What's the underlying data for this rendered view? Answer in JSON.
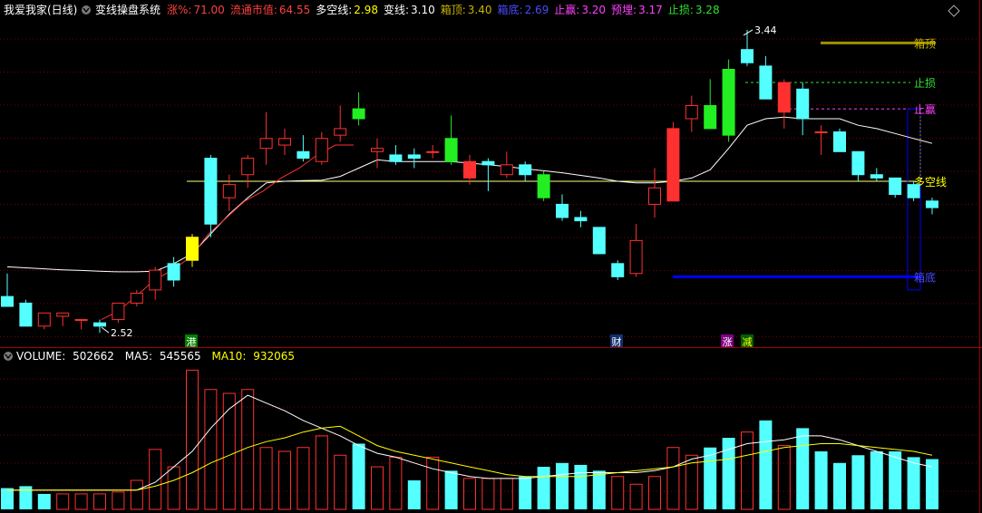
{
  "header": {
    "stock_name": "我爱我家(日线)",
    "system_name": "变线操盘系统",
    "items": [
      {
        "label": "涨%:",
        "value": "71.00",
        "label_color": "#ff4040",
        "value_color": "#ff4040"
      },
      {
        "label": "流通市值:",
        "value": "64.55",
        "label_color": "#ff4040",
        "value_color": "#ff4040"
      },
      {
        "label": "多空线:",
        "value": "2.98",
        "label_color": "#ffffff",
        "value_color": "#ffff00"
      },
      {
        "label": "变线:",
        "value": "3.10",
        "label_color": "#ffffff",
        "value_color": "#ffffff"
      },
      {
        "label": "箱顶:",
        "value": "3.40",
        "label_color": "#c8b400",
        "value_color": "#c8b400"
      },
      {
        "label": "箱底:",
        "value": "2.69",
        "label_color": "#4a4aff",
        "value_color": "#4a4aff"
      },
      {
        "label": "止赢:",
        "value": "3.20",
        "label_color": "#ff40ff",
        "value_color": "#ff40ff"
      },
      {
        "label": "预埋:",
        "value": "3.17",
        "label_color": "#ff40ff",
        "value_color": "#ff40ff"
      },
      {
        "label": "止损:",
        "value": "3.28",
        "label_color": "#30e030",
        "value_color": "#30e030"
      }
    ]
  },
  "volume_header": {
    "label": "VOLUME:",
    "value": "502662",
    "ma5_label": "MA5:",
    "ma5_value": "545565",
    "ma10_label": "MA10:",
    "ma10_value": "932065"
  },
  "markers": [
    "港",
    "财",
    "涨",
    "减"
  ],
  "colors": {
    "up": "#ff3030",
    "down": "#54ffff",
    "yellow_candle": "#ffff00",
    "green_candle": "#22ee22",
    "ma_line": "#ffffff",
    "bull_line": "#ff3030",
    "duokong": "#ffff80",
    "box_top": "#a09000",
    "box_bottom": "#0000ff",
    "stop_loss": "#30e030",
    "stop_profit": "#ff40ff",
    "grid": "#7a0000"
  },
  "chart_data": {
    "type": "candlestick",
    "price_annotations": {
      "high": "3.44",
      "low": "2.52"
    },
    "levels": [
      {
        "name": "箱顶",
        "value": 3.4
      },
      {
        "name": "止损",
        "value": 3.28
      },
      {
        "name": "止赢",
        "value": 3.2
      },
      {
        "name": "多空线",
        "value": 2.98
      },
      {
        "name": "箱底",
        "value": 2.69
      }
    ],
    "candles": [
      {
        "o": 2.63,
        "h": 2.7,
        "l": 2.6,
        "c": 2.6,
        "mark": ""
      },
      {
        "o": 2.61,
        "h": 2.62,
        "l": 2.54,
        "c": 2.54,
        "mark": ""
      },
      {
        "o": 2.54,
        "h": 2.58,
        "l": 2.53,
        "c": 2.58,
        "mark": ""
      },
      {
        "o": 2.57,
        "h": 2.58,
        "l": 2.54,
        "c": 2.58,
        "mark": ""
      },
      {
        "o": 2.56,
        "h": 2.56,
        "l": 2.53,
        "c": 2.56,
        "mark": ""
      },
      {
        "o": 2.55,
        "h": 2.56,
        "l": 2.52,
        "c": 2.54,
        "mark": ""
      },
      {
        "o": 2.56,
        "h": 2.61,
        "l": 2.55,
        "c": 2.61,
        "mark": ""
      },
      {
        "o": 2.61,
        "h": 2.65,
        "l": 2.6,
        "c": 2.64,
        "mark": ""
      },
      {
        "o": 2.65,
        "h": 2.72,
        "l": 2.62,
        "c": 2.71,
        "mark": ""
      },
      {
        "o": 2.73,
        "h": 2.75,
        "l": 2.66,
        "c": 2.68,
        "mark": ""
      },
      {
        "o": 2.74,
        "h": 2.82,
        "l": 2.72,
        "c": 2.81,
        "mark": "yellow"
      },
      {
        "o": 3.05,
        "h": 3.06,
        "l": 2.81,
        "c": 2.85,
        "mark": ""
      },
      {
        "o": 2.93,
        "h": 3.0,
        "l": 2.89,
        "c": 2.97,
        "mark": ""
      },
      {
        "o": 3.0,
        "h": 3.06,
        "l": 2.96,
        "c": 3.05,
        "mark": ""
      },
      {
        "o": 3.08,
        "h": 3.19,
        "l": 3.03,
        "c": 3.11,
        "mark": ""
      },
      {
        "o": 3.09,
        "h": 3.14,
        "l": 3.06,
        "c": 3.11,
        "mark": ""
      },
      {
        "o": 3.07,
        "h": 3.12,
        "l": 3.04,
        "c": 3.05,
        "mark": ""
      },
      {
        "o": 3.04,
        "h": 3.13,
        "l": 3.03,
        "c": 3.11,
        "mark": ""
      },
      {
        "o": 3.12,
        "h": 3.21,
        "l": 3.1,
        "c": 3.14,
        "mark": ""
      },
      {
        "o": 3.17,
        "h": 3.25,
        "l": 3.15,
        "c": 3.2,
        "mark": "green"
      },
      {
        "o": 3.07,
        "h": 3.11,
        "l": 3.02,
        "c": 3.08,
        "mark": ""
      },
      {
        "o": 3.06,
        "h": 3.09,
        "l": 3.03,
        "c": 3.04,
        "mark": ""
      },
      {
        "o": 3.06,
        "h": 3.08,
        "l": 3.02,
        "c": 3.05,
        "mark": ""
      },
      {
        "o": 3.07,
        "h": 3.09,
        "l": 3.05,
        "c": 3.07,
        "mark": ""
      },
      {
        "o": 3.11,
        "h": 3.18,
        "l": 3.03,
        "c": 3.04,
        "mark": "green"
      },
      {
        "o": 3.04,
        "h": 3.06,
        "l": 2.97,
        "c": 2.99,
        "mark": "red"
      },
      {
        "o": 3.04,
        "h": 3.05,
        "l": 2.95,
        "c": 3.03,
        "mark": ""
      },
      {
        "o": 3.0,
        "h": 3.07,
        "l": 2.99,
        "c": 3.03,
        "mark": ""
      },
      {
        "o": 3.03,
        "h": 3.04,
        "l": 2.98,
        "c": 3.0,
        "mark": ""
      },
      {
        "o": 3.0,
        "h": 3.01,
        "l": 2.92,
        "c": 2.93,
        "mark": "green"
      },
      {
        "o": 2.91,
        "h": 2.94,
        "l": 2.86,
        "c": 2.87,
        "mark": ""
      },
      {
        "o": 2.87,
        "h": 2.89,
        "l": 2.84,
        "c": 2.86,
        "mark": ""
      },
      {
        "o": 2.84,
        "h": 2.84,
        "l": 2.76,
        "c": 2.76,
        "mark": ""
      },
      {
        "o": 2.73,
        "h": 2.74,
        "l": 2.68,
        "c": 2.69,
        "mark": ""
      },
      {
        "o": 2.7,
        "h": 2.85,
        "l": 2.69,
        "c": 2.8,
        "mark": ""
      },
      {
        "o": 2.91,
        "h": 3.02,
        "l": 2.87,
        "c": 2.96,
        "mark": ""
      },
      {
        "o": 2.92,
        "h": 3.16,
        "l": 2.92,
        "c": 3.14,
        "mark": "red"
      },
      {
        "o": 3.17,
        "h": 3.24,
        "l": 3.13,
        "c": 3.21,
        "mark": ""
      },
      {
        "o": 3.21,
        "h": 3.29,
        "l": 3.15,
        "c": 3.14,
        "mark": "green"
      },
      {
        "o": 3.32,
        "h": 3.35,
        "l": 3.1,
        "c": 3.12,
        "mark": "green"
      },
      {
        "o": 3.38,
        "h": 3.44,
        "l": 3.33,
        "c": 3.34,
        "mark": ""
      },
      {
        "o": 3.33,
        "h": 3.36,
        "l": 3.23,
        "c": 3.23,
        "mark": ""
      },
      {
        "o": 3.28,
        "h": 3.29,
        "l": 3.14,
        "c": 3.19,
        "mark": "red"
      },
      {
        "o": 3.26,
        "h": 3.28,
        "l": 3.12,
        "c": 3.17,
        "mark": ""
      },
      {
        "o": 3.13,
        "h": 3.15,
        "l": 3.06,
        "c": 3.13,
        "mark": ""
      },
      {
        "o": 3.13,
        "h": 3.14,
        "l": 3.07,
        "c": 3.07,
        "mark": ""
      },
      {
        "o": 3.07,
        "h": 3.07,
        "l": 2.98,
        "c": 3.0,
        "mark": ""
      },
      {
        "o": 3.0,
        "h": 3.02,
        "l": 2.98,
        "c": 2.99,
        "mark": ""
      },
      {
        "o": 2.99,
        "h": 2.99,
        "l": 2.93,
        "c": 2.94,
        "mark": ""
      },
      {
        "o": 2.97,
        "h": 2.98,
        "l": 2.92,
        "c": 2.93,
        "mark": ""
      },
      {
        "o": 2.92,
        "h": 2.93,
        "l": 2.88,
        "c": 2.9,
        "mark": ""
      }
    ],
    "ma": [
      2.72,
      2.717,
      2.714,
      2.711,
      2.709,
      2.707,
      2.705,
      2.705,
      2.707,
      2.73,
      2.76,
      2.82,
      2.88,
      2.93,
      2.975,
      2.98,
      2.982,
      2.983,
      2.995,
      3.02,
      3.045,
      3.04,
      3.04,
      3.04,
      3.04,
      3.035,
      3.03,
      3.025,
      3.018,
      3.012,
      3.006,
      2.998,
      2.99,
      2.98,
      2.975,
      2.975,
      2.98,
      2.99,
      3.015,
      3.08,
      3.15,
      3.17,
      3.175,
      3.17,
      3.17,
      3.17,
      3.15,
      3.14,
      3.125,
      3.11,
      3.095
    ],
    "volume": [
      0.11,
      0.12,
      0.08,
      0.08,
      0.08,
      0.08,
      0.09,
      0.15,
      0.31,
      0.22,
      0.72,
      0.62,
      0.6,
      0.62,
      0.32,
      0.3,
      0.32,
      0.38,
      0.28,
      0.34,
      0.22,
      0.27,
      0.15,
      0.27,
      0.2,
      0.16,
      0.16,
      0.16,
      0.17,
      0.22,
      0.24,
      0.23,
      0.2,
      0.17,
      0.13,
      0.17,
      0.32,
      0.28,
      0.32,
      0.37,
      0.4,
      0.46,
      0.33,
      0.42,
      0.3,
      0.24,
      0.28,
      0.3,
      0.3,
      0.27,
      0.26
    ],
    "volume_up": [
      0,
      0,
      0,
      1,
      1,
      1,
      1,
      1,
      1,
      1,
      1,
      1,
      1,
      1,
      1,
      1,
      1,
      1,
      1,
      0,
      1,
      1,
      0,
      1,
      0,
      1,
      1,
      1,
      0,
      0,
      0,
      0,
      0,
      1,
      1,
      1,
      1,
      1,
      0,
      0,
      1,
      0,
      1,
      0,
      0,
      0,
      0,
      0,
      0,
      0,
      0
    ],
    "vol_ma_white": [
      0.1,
      0.1,
      0.1,
      0.1,
      0.1,
      0.1,
      0.1,
      0.1,
      0.14,
      0.22,
      0.3,
      0.42,
      0.52,
      0.59,
      0.55,
      0.51,
      0.46,
      0.42,
      0.38,
      0.33,
      0.29,
      0.27,
      0.24,
      0.21,
      0.19,
      0.17,
      0.16,
      0.16,
      0.16,
      0.17,
      0.18,
      0.19,
      0.19,
      0.19,
      0.19,
      0.2,
      0.22,
      0.26,
      0.28,
      0.31,
      0.34,
      0.35,
      0.36,
      0.38,
      0.38,
      0.36,
      0.33,
      0.3,
      0.27,
      0.24,
      0.22
    ],
    "vol_ma_yellow": [
      0.1,
      0.1,
      0.1,
      0.1,
      0.1,
      0.1,
      0.1,
      0.1,
      0.12,
      0.15,
      0.19,
      0.24,
      0.28,
      0.32,
      0.35,
      0.37,
      0.4,
      0.42,
      0.43,
      0.38,
      0.33,
      0.3,
      0.28,
      0.26,
      0.24,
      0.22,
      0.2,
      0.18,
      0.17,
      0.17,
      0.17,
      0.17,
      0.18,
      0.19,
      0.2,
      0.21,
      0.22,
      0.24,
      0.25,
      0.26,
      0.28,
      0.3,
      0.32,
      0.33,
      0.34,
      0.34,
      0.33,
      0.32,
      0.31,
      0.3,
      0.28
    ]
  }
}
